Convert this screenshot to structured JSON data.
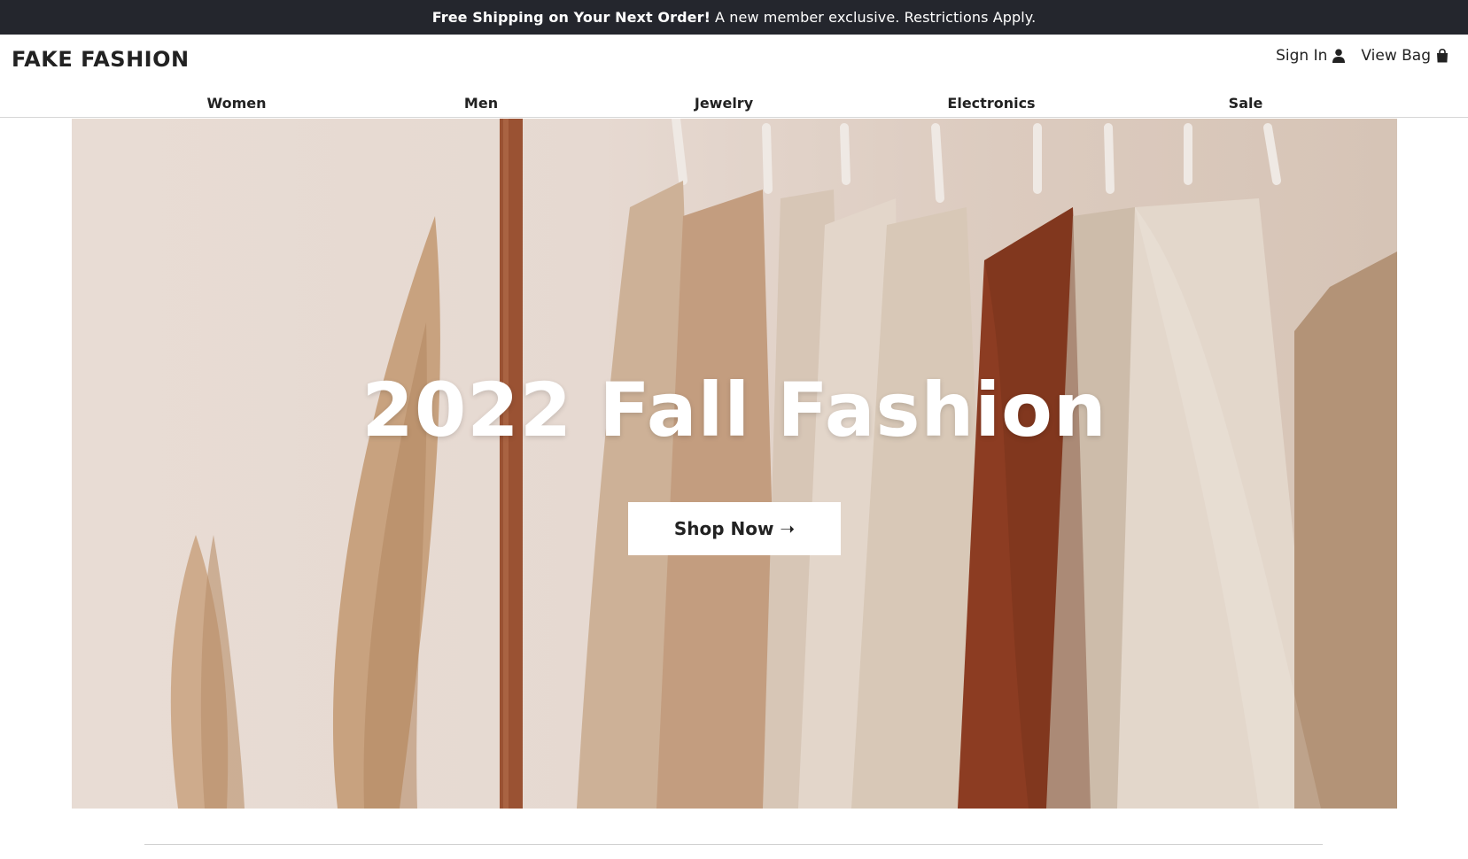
{
  "promo": {
    "bold_text": "Free Shipping on Your Next Order!",
    "text": "A new member exclusive. Restrictions Apply."
  },
  "header": {
    "logo": "FAKE FASHION",
    "sign_in": "Sign In",
    "view_bag": "View Bag"
  },
  "nav": {
    "items": [
      {
        "label": "Women"
      },
      {
        "label": "Men"
      },
      {
        "label": "Jewelry"
      },
      {
        "label": "Electronics"
      },
      {
        "label": "Sale"
      }
    ]
  },
  "hero": {
    "title": "2022 Fall Fashion",
    "cta": "Shop Now ➝"
  },
  "icons": {
    "sign_in": "user-icon",
    "view_bag": "shopping-bag-icon"
  },
  "colors": {
    "promo_bg": "#24262d",
    "text": "#222222",
    "button_bg": "#ffffff"
  }
}
